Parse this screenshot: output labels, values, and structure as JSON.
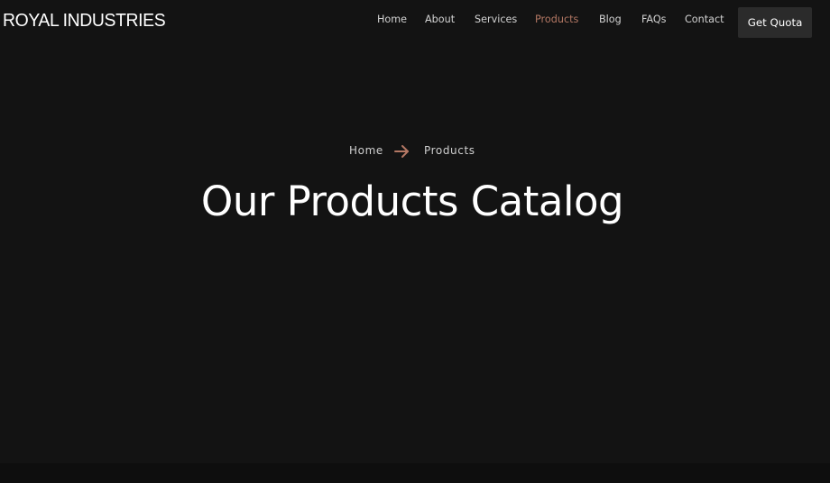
{
  "header": {
    "logo": "ROYAL INDUSTRIES",
    "nav": [
      {
        "label": "Home",
        "active": false
      },
      {
        "label": "About",
        "active": false
      },
      {
        "label": "Services",
        "active": false
      },
      {
        "label": "Products",
        "active": true
      },
      {
        "label": "Blog",
        "active": false
      },
      {
        "label": "FAQs",
        "active": false
      },
      {
        "label": "Contact",
        "active": false
      }
    ],
    "cta_label": "Get Quota"
  },
  "breadcrumb": {
    "home": "Home",
    "separator_icon": "arrow-right-icon",
    "current": "Products"
  },
  "hero": {
    "title": "Our Products Catalog"
  },
  "colors": {
    "background": "#131313",
    "accent": "#b47864",
    "nav_text": "#d2d2d2",
    "button_bg": "#2b2b2b",
    "title": "#ffffff"
  }
}
